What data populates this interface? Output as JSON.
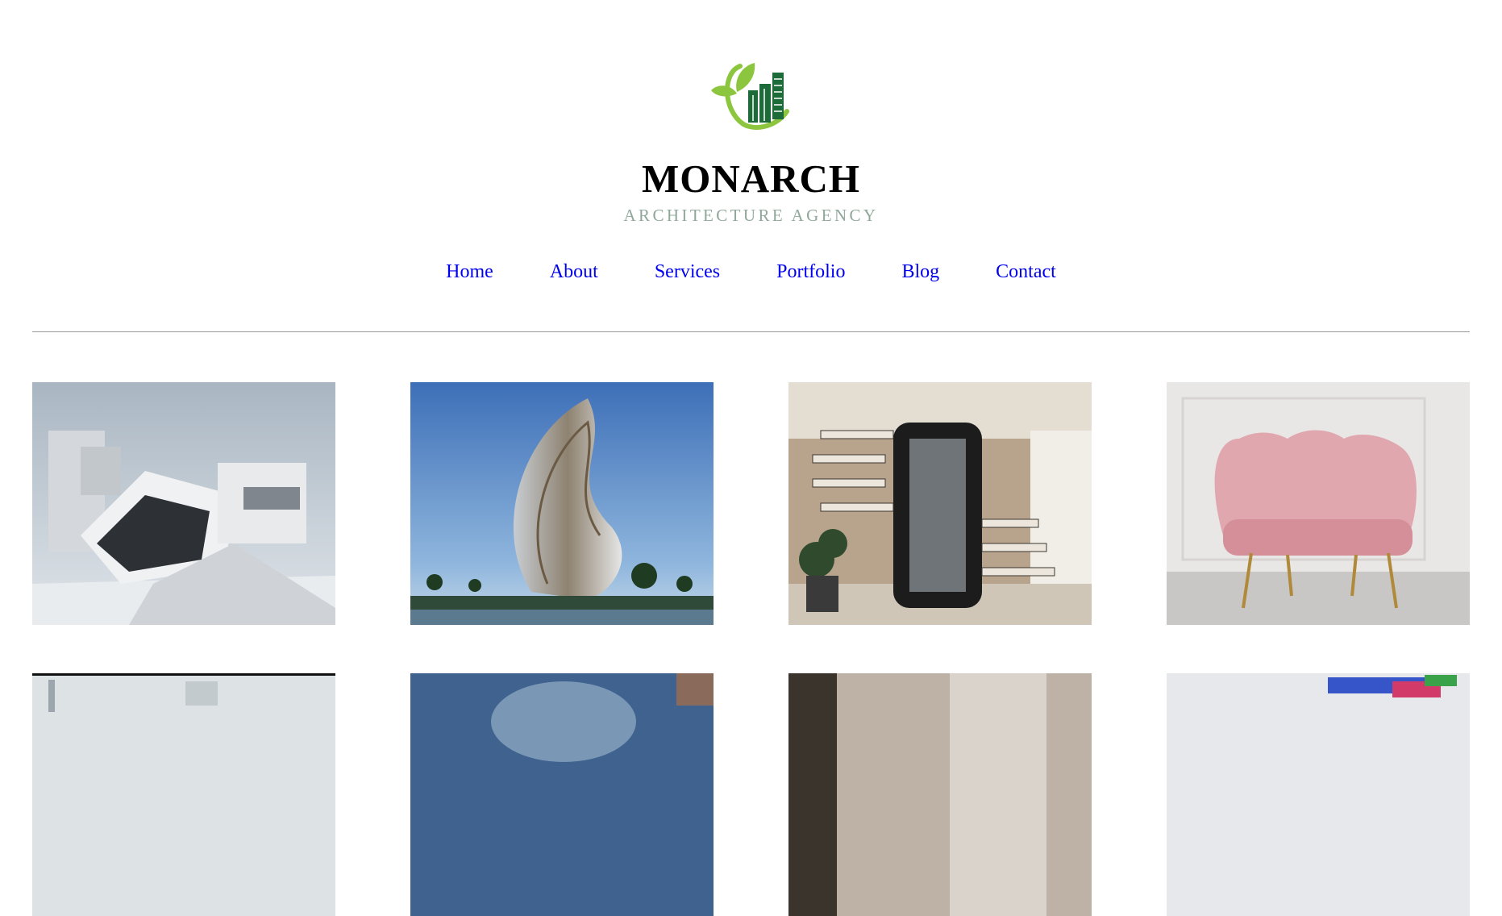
{
  "brand": {
    "name": "MONARCH",
    "tagline": "ARCHITECTURE AGENCY",
    "logo_icon": "leaf-building-logo",
    "colors": {
      "leaf": "#8cc63f",
      "building": "#1e6b3a"
    }
  },
  "nav": {
    "items": [
      {
        "label": "Home"
      },
      {
        "label": "About"
      },
      {
        "label": "Services"
      },
      {
        "label": "Portfolio"
      },
      {
        "label": "Blog"
      },
      {
        "label": "Contact"
      }
    ],
    "link_color": "#0000ee"
  },
  "gallery": {
    "images": [
      {
        "subject": "modern-white-house"
      },
      {
        "subject": "twisted-tower"
      },
      {
        "subject": "spiral-staircase-elevator"
      },
      {
        "subject": "pink-shell-armchair"
      },
      {
        "subject": "building-interior"
      },
      {
        "subject": "glass-dome-building"
      },
      {
        "subject": "beige-room"
      },
      {
        "subject": "colorful-objects"
      }
    ]
  }
}
